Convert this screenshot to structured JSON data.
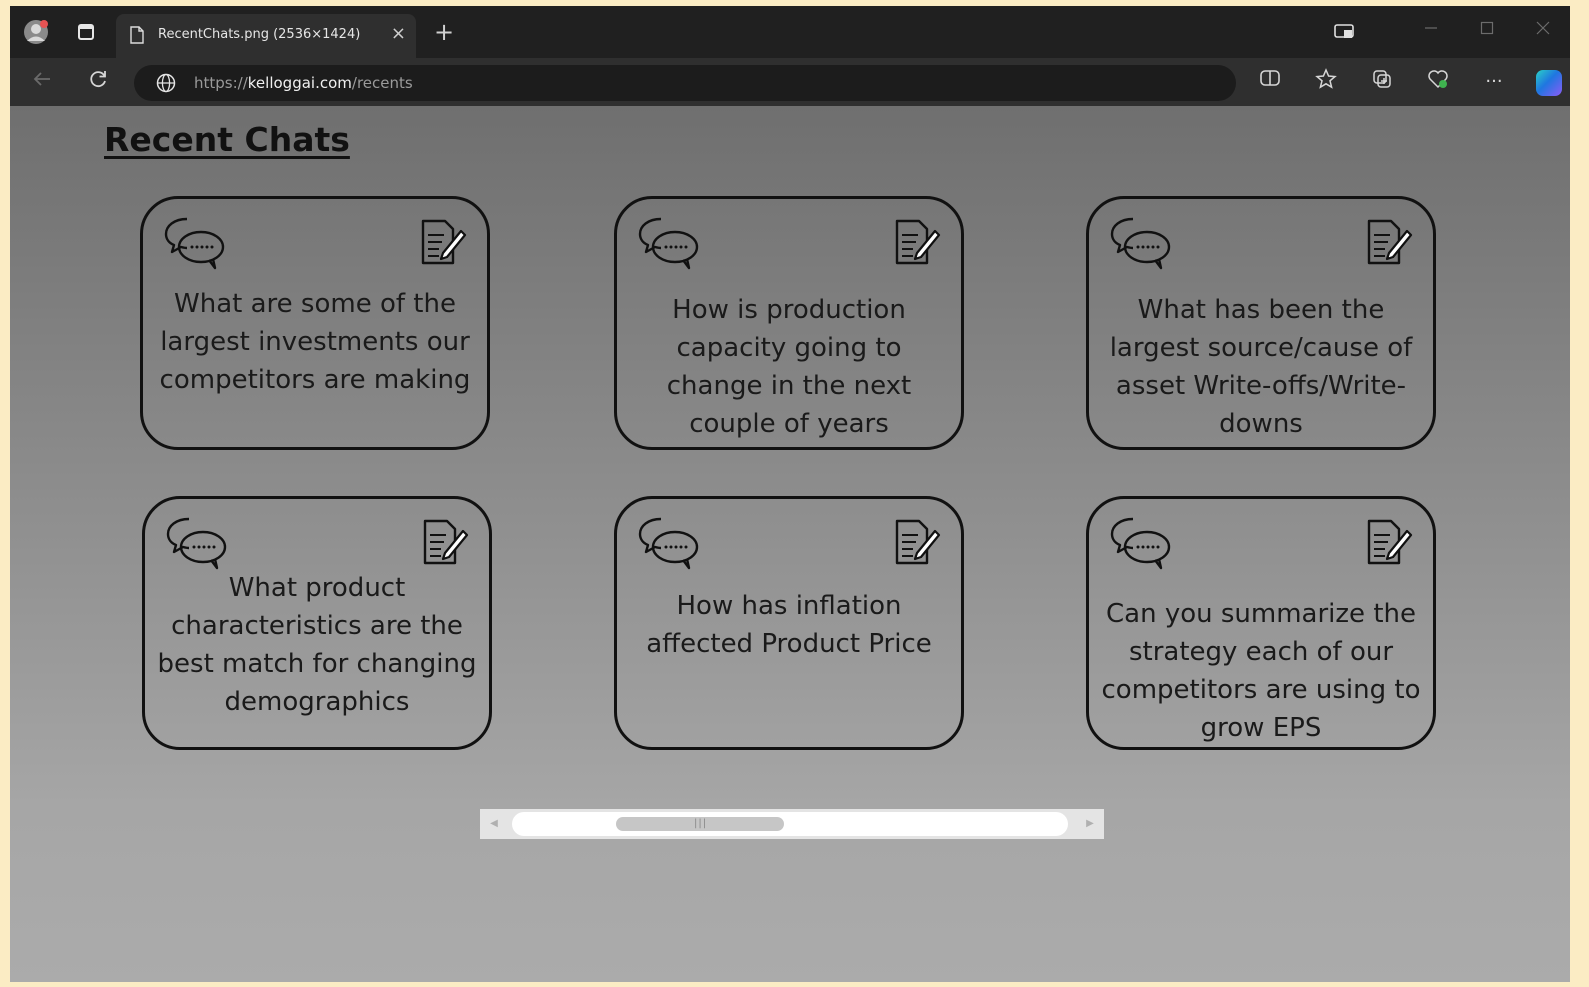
{
  "browser": {
    "tab_title": "RecentChats.png (2536×1424)",
    "url_scheme": "https://",
    "url_host": "kelloggai.com",
    "url_path": "/recents",
    "new_tab_label": "+",
    "close_tab_label": "×",
    "more_label": "···"
  },
  "page": {
    "title": "Recent Chats",
    "cards": [
      {
        "question": "What are some of the largest investments our competitors are making"
      },
      {
        "question": "How is production capacity going to change in the next couple of years"
      },
      {
        "question": "What has been the largest source/cause of asset Write-offs/Write-downs"
      },
      {
        "question": "What product characteristics are the best match for changing demographics"
      },
      {
        "question": "How has inflation affected Product Price"
      },
      {
        "question": "Can you summarize the strategy each of our competitors are using to grow EPS"
      }
    ],
    "card_icons": {
      "left": "chat-bubbles-icon",
      "right": "edit-document-icon"
    }
  },
  "colors": {
    "outer_frame": "#fbecc4",
    "browser_chrome": "#202020",
    "card_border": "#111111",
    "page_gradient_top": "#6f6f6f",
    "page_gradient_bottom": "#ababab"
  }
}
